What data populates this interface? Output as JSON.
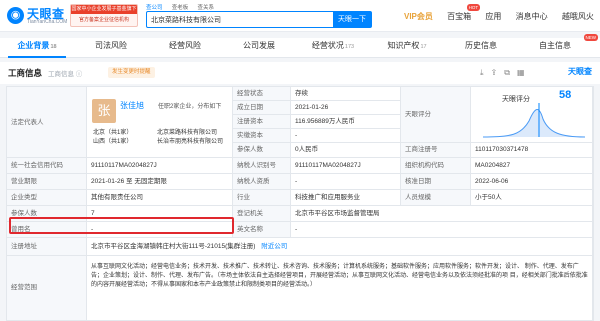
{
  "header": {
    "logo_main": "天眼查",
    "logo_sub": "TianYanCha.COM",
    "banner_top": "国家中小企业发展子基金旗下",
    "banner_bottom": "官方备案企业征信机构",
    "search_tabs": [
      "查公司",
      "查老板",
      "查关系"
    ],
    "search_value": "北京菜路科技有限公司",
    "search_button": "天眼一下",
    "nav": [
      {
        "label": "VIP会员",
        "badge": ""
      },
      {
        "label": "百宝箱",
        "badge": "HOT"
      },
      {
        "label": "应用",
        "badge": ""
      },
      {
        "label": "消息中心",
        "badge": ""
      },
      {
        "label": "越哦风火",
        "badge": ""
      }
    ]
  },
  "tabs": [
    {
      "label": "企业背景",
      "count": "18",
      "active": true,
      "new": false
    },
    {
      "label": "司法风险",
      "count": "",
      "active": false,
      "new": false
    },
    {
      "label": "经营风险",
      "count": "",
      "active": false,
      "new": false
    },
    {
      "label": "公司发展",
      "count": "",
      "active": false,
      "new": false
    },
    {
      "label": "经营状况",
      "count": "173",
      "active": false,
      "new": false
    },
    {
      "label": "知识产权",
      "count": "17",
      "active": false,
      "new": false
    },
    {
      "label": "历史信息",
      "count": "",
      "active": false,
      "new": false
    },
    {
      "label": "自主信息",
      "count": "",
      "active": false,
      "new": true
    }
  ],
  "info": {
    "title": "工商信息",
    "subtitle": "工商信息 ⓘ",
    "tag": "发生变更时提醒",
    "eye_logo": "天眼查"
  },
  "rep": {
    "label": "法定代表人",
    "avatar_char": "张",
    "name": "张佳旭",
    "note": "任职2家企业，分布如下",
    "regions": [
      "北京（共1家）",
      "山西（共1家）"
    ],
    "companies": [
      "北京菜路科技有限公司",
      "长治市朋亮科技有限公司"
    ]
  },
  "score": {
    "title": "天眼评分",
    "value": "58"
  },
  "grid": {
    "status_label": "经营状态",
    "status_value": "存续",
    "found_label": "成立日期",
    "found_value": "2021-01-26",
    "capital_label": "注册资本",
    "capital_value": "116.956889万人民币",
    "paid_label": "实缴资本",
    "paid_value": "-",
    "staff_label": "参保人数",
    "staff_value": "0人民币",
    "eng_label": "工商注册号",
    "eng_value": "110117030371478",
    "usc_label": "统一社会信用代码",
    "usc_value": "91110117MA0204827J",
    "taxid_label": "纳税人识别号",
    "taxid_value": "91110117MA0204827J",
    "org_label": "组织机构代码",
    "org_value": "MA0204827",
    "term_label": "营业期限",
    "term_value": "2021-01-26 至 无固定期限",
    "taxq_label": "纳税人资质",
    "taxq_value": "-",
    "approve_label": "核准日期",
    "approve_value": "2022-06-06",
    "type_label": "企业类型",
    "type_value": "其他有限责任公司",
    "industry_label": "行业",
    "industry_value": "科技推广和应用服务业",
    "scale_label": "人员规模",
    "scale_value": "小于50人",
    "insured_label": "参保人数",
    "insured_value": "7",
    "regorg_label": "登记机关",
    "regorg_value": "北京市平谷区市场监督管理局",
    "former_label": "曾用名",
    "former_value": "-",
    "engname_label": "英文名称",
    "engname_value": "-",
    "addr_label": "注册地址",
    "addr_value": "北京市平谷区金海湖镇韩庄村大街111号-21015(集群注册)",
    "addr_link": "附近公司",
    "scope_label": "经营范围",
    "scope_line1": "从事互联网文化活动；经营电信业务；技术开发、技术推广、技术转让、技术咨询、技术服务；计算机系统服务；基础软件服务；应用软件服务；软件开发；设计、",
    "scope_line2": "制作、代理、发布广告；企业策划；设计、制作、代理、发布广告。（市场主体依法自主选择经营项目，开展经营活动；从事互联网文化活动、经营电信业务以及依法须经批准的项",
    "scope_line3": "目，经相关部门批准后依批准的内容开展经营活动；不得从事国家和本市产业政策禁止和限制类项目的经营活动。）"
  }
}
